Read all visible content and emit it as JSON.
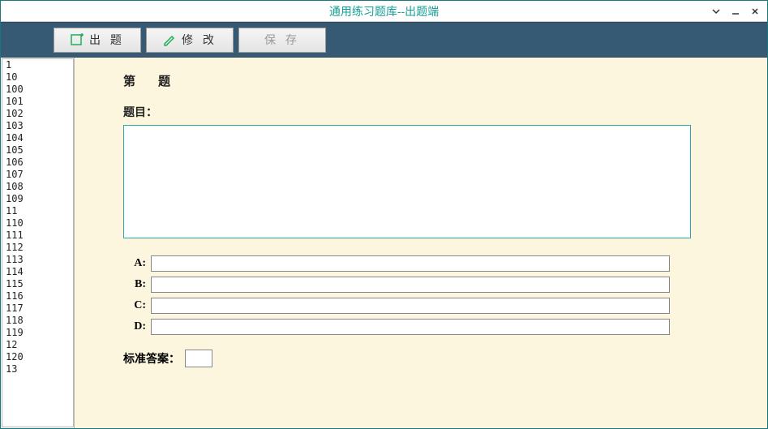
{
  "titlebar": {
    "title": "通用练习题库--出题端"
  },
  "toolbar": {
    "new_label": "出 题",
    "edit_label": "修 改",
    "save_label": "保 存"
  },
  "sidebar": {
    "items": [
      "1",
      "10",
      "100",
      "101",
      "102",
      "103",
      "104",
      "105",
      "106",
      "107",
      "108",
      "109",
      "11",
      "110",
      "111",
      "112",
      "113",
      "114",
      "115",
      "116",
      "117",
      "118",
      "119",
      "12",
      "120",
      "13"
    ]
  },
  "main": {
    "qnum_prefix": "第",
    "qnum_value": "",
    "qnum_suffix": "题",
    "question_label": "题目：",
    "question_value": "",
    "options": [
      {
        "label": "A:",
        "value": ""
      },
      {
        "label": "B:",
        "value": ""
      },
      {
        "label": "C:",
        "value": ""
      },
      {
        "label": "D:",
        "value": ""
      }
    ],
    "answer_label": "标准答案：",
    "answer_value": ""
  }
}
